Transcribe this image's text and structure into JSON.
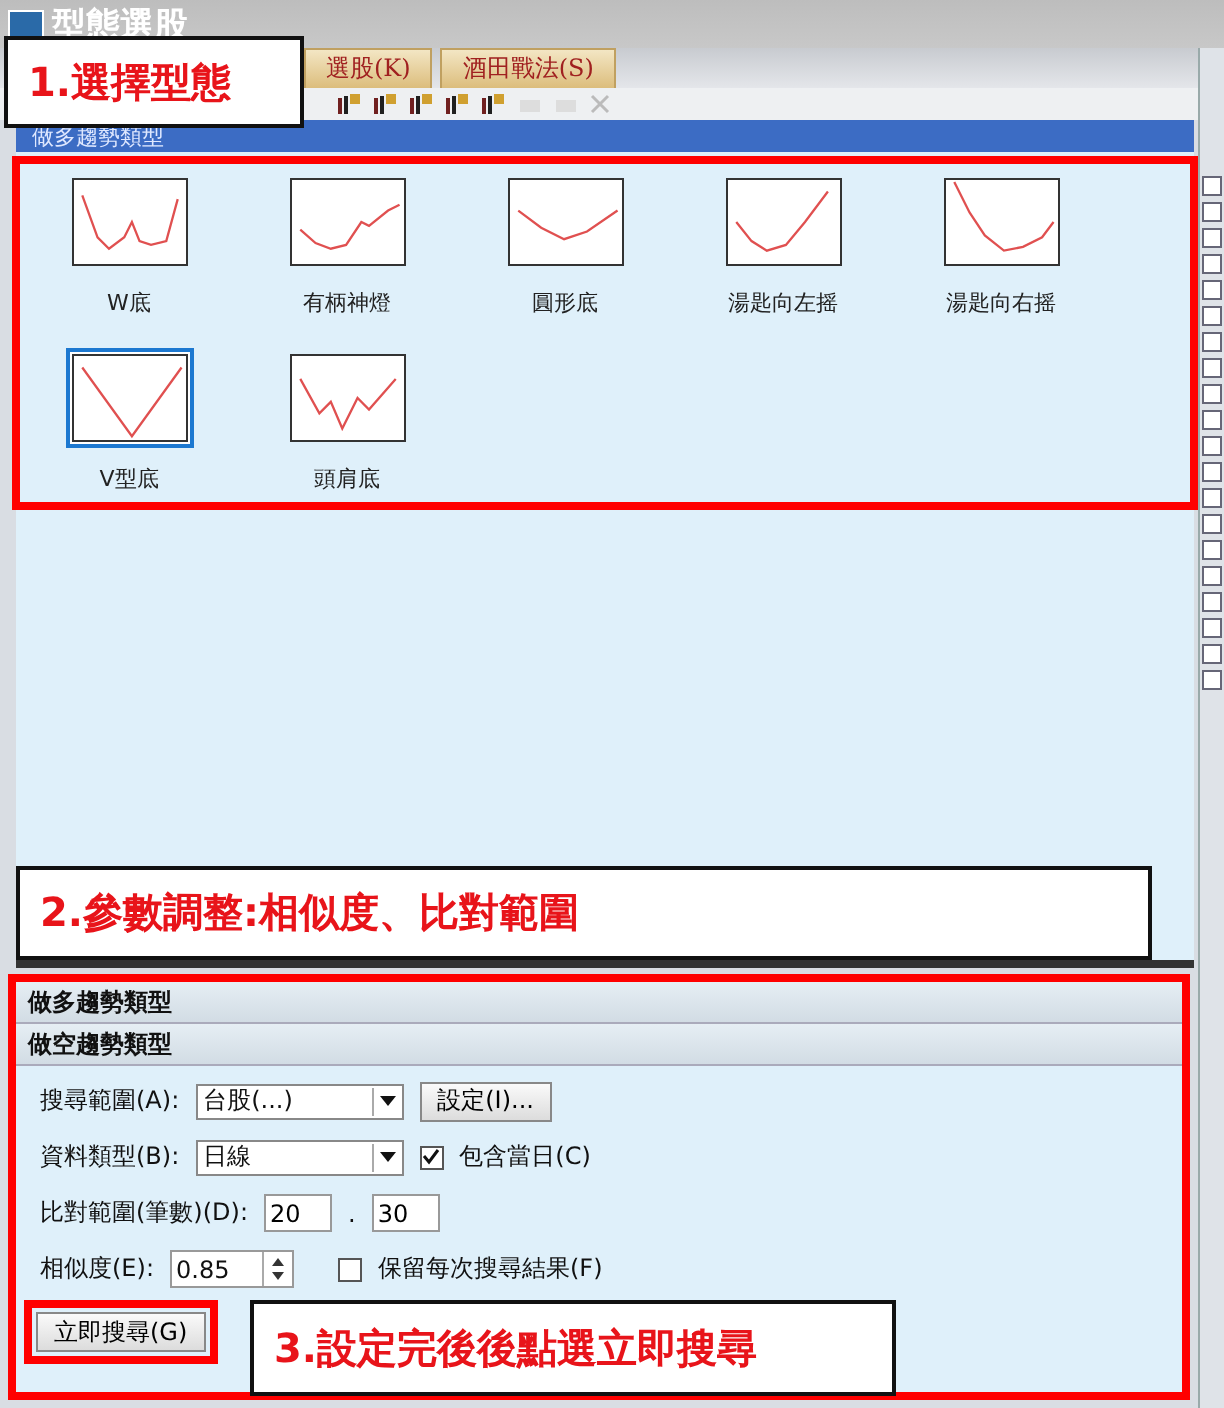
{
  "window": {
    "title": "型態選股"
  },
  "tabs": [
    {
      "label": "選股(K)"
    },
    {
      "label": "酒田戰法(S)"
    }
  ],
  "pattern_panel": {
    "title": "做多趨勢類型",
    "patterns": [
      {
        "label": "W底",
        "kind": "w",
        "selected": false
      },
      {
        "label": "有柄神燈",
        "kind": "cup",
        "selected": false
      },
      {
        "label": "圓形底",
        "kind": "round",
        "selected": false
      },
      {
        "label": "湯匙向左摇",
        "kind": "spoon_left",
        "selected": false
      },
      {
        "label": "湯匙向右摇",
        "kind": "spoon_right",
        "selected": false
      },
      {
        "label": "V型底",
        "kind": "v",
        "selected": true
      },
      {
        "label": "頭肩底",
        "kind": "head_shoulders",
        "selected": false
      }
    ]
  },
  "sections": [
    {
      "title": "做多趨勢類型"
    },
    {
      "title": "做空趨勢類型"
    }
  ],
  "form": {
    "search_range": {
      "label": "搜尋範圍(A):",
      "value": "台股(...)"
    },
    "settings_button": "設定(I)...",
    "data_type": {
      "label": "資料類型(B):",
      "value": "日線"
    },
    "include_today": {
      "label": "包含當日(C)",
      "checked": true
    },
    "compare_range": {
      "label": "比對範圍(筆數)(D):",
      "from": "20",
      "separator": ".",
      "to": "30"
    },
    "similarity": {
      "label": "相似度(E):",
      "value": "0.85"
    },
    "keep_results": {
      "label": "保留每次搜尋結果(F)",
      "checked": false
    },
    "search_button": "立即搜尋(G)"
  },
  "annotations": [
    {
      "text": "1.選擇型態"
    },
    {
      "text": "2.參數調整:相似度、比對範圍"
    },
    {
      "text": "3.設定完後後點選立即搜尋"
    }
  ]
}
